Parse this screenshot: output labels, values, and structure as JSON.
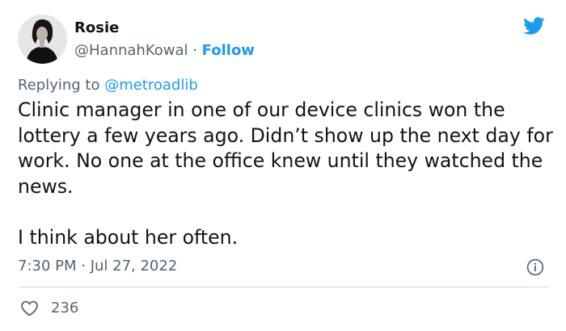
{
  "tweet": {
    "author": {
      "display_name": "Rosie",
      "handle": "@HannahKowal",
      "separator": " · ",
      "follow_label": "Follow",
      "avatar_icon": "avatar-photo"
    },
    "brand_icon": "twitter-bird-icon",
    "brand_color": "#1d9bf0",
    "replying_prefix": "Replying to ",
    "replying_to": "@metroadlib",
    "body_paragraphs": [
      "Clinic manager in one of our device clinics won the lottery a few years ago. Didn’t show up the next day for work. No one at the office knew until they watched the news.",
      "I think about her often."
    ],
    "timestamp": "7:30 PM · Jul 27, 2022",
    "info_icon": "info-icon",
    "like_icon": "heart-icon",
    "like_count": "236"
  }
}
